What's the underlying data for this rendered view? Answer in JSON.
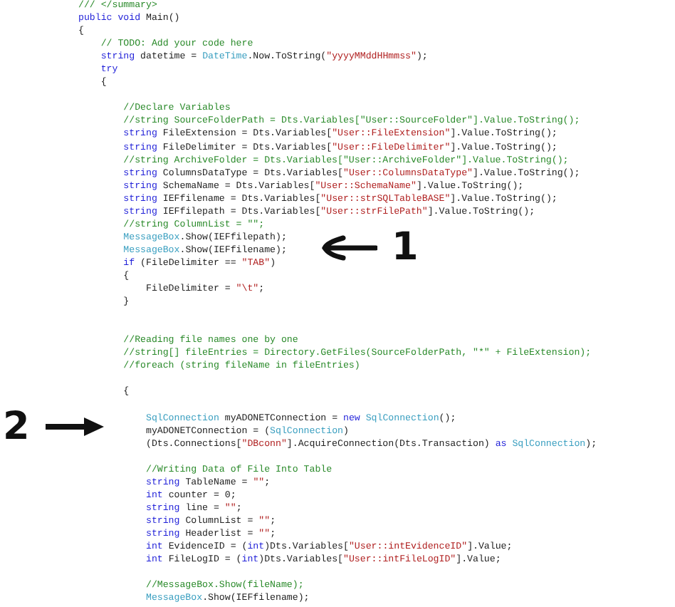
{
  "code_lines": [
    {
      "kind": "code",
      "tokens": [
        {
          "kind": "comment",
          "text": "/// </summary>"
        }
      ]
    },
    {
      "kind": "code",
      "tokens": [
        {
          "kind": "keyword",
          "text": "public void"
        },
        {
          "kind": "plain",
          "text": " Main()"
        }
      ]
    },
    {
      "kind": "code",
      "tokens": [
        {
          "kind": "plain",
          "text": "{"
        }
      ]
    },
    {
      "kind": "code",
      "tokens": [
        {
          "kind": "comment",
          "text": "    // TODO: Add your code here"
        }
      ]
    },
    {
      "kind": "code",
      "tokens": [
        {
          "kind": "keyword",
          "text": "    string"
        },
        {
          "kind": "plain",
          "text": " datetime = "
        },
        {
          "kind": "type",
          "text": "DateTime"
        },
        {
          "kind": "plain",
          "text": ".Now.ToString("
        },
        {
          "kind": "string",
          "text": "\"yyyyMMddHHmmss\""
        },
        {
          "kind": "plain",
          "text": ");"
        }
      ]
    },
    {
      "kind": "code",
      "tokens": [
        {
          "kind": "keyword",
          "text": "    try"
        }
      ]
    },
    {
      "kind": "code",
      "tokens": [
        {
          "kind": "plain",
          "text": "    {"
        }
      ]
    },
    {
      "kind": "blank"
    },
    {
      "kind": "code",
      "tokens": [
        {
          "kind": "comment",
          "text": "        //Declare Variables"
        }
      ]
    },
    {
      "kind": "code",
      "tokens": [
        {
          "kind": "comment",
          "text": "        //string SourceFolderPath = Dts.Variables[\"User::SourceFolder\"].Value.ToString();"
        }
      ]
    },
    {
      "kind": "code",
      "tokens": [
        {
          "kind": "keyword",
          "text": "        string"
        },
        {
          "kind": "plain",
          "text": " FileExtension = Dts.Variables["
        },
        {
          "kind": "string",
          "text": "\"User::FileExtension\""
        },
        {
          "kind": "plain",
          "text": "].Value.ToString();"
        }
      ]
    },
    {
      "kind": "code",
      "tokens": [
        {
          "kind": "keyword",
          "text": "        string"
        },
        {
          "kind": "plain",
          "text": " FileDelimiter = Dts.Variables["
        },
        {
          "kind": "string",
          "text": "\"User::FileDelimiter\""
        },
        {
          "kind": "plain",
          "text": "].Value.ToString();"
        }
      ]
    },
    {
      "kind": "code",
      "tokens": [
        {
          "kind": "comment",
          "text": "        //string ArchiveFolder = Dts.Variables[\"User::ArchiveFolder\"].Value.ToString();"
        }
      ]
    },
    {
      "kind": "code",
      "tokens": [
        {
          "kind": "keyword",
          "text": "        string"
        },
        {
          "kind": "plain",
          "text": " ColumnsDataType = Dts.Variables["
        },
        {
          "kind": "string",
          "text": "\"User::ColumnsDataType\""
        },
        {
          "kind": "plain",
          "text": "].Value.ToString();"
        }
      ]
    },
    {
      "kind": "code",
      "tokens": [
        {
          "kind": "keyword",
          "text": "        string"
        },
        {
          "kind": "plain",
          "text": " SchemaName = Dts.Variables["
        },
        {
          "kind": "string",
          "text": "\"User::SchemaName\""
        },
        {
          "kind": "plain",
          "text": "].Value.ToString();"
        }
      ]
    },
    {
      "kind": "code",
      "tokens": [
        {
          "kind": "keyword",
          "text": "        string"
        },
        {
          "kind": "plain",
          "text": " IEFfilename = Dts.Variables["
        },
        {
          "kind": "string",
          "text": "\"User::strSQLTableBASE\""
        },
        {
          "kind": "plain",
          "text": "].Value.ToString();"
        }
      ]
    },
    {
      "kind": "code",
      "tokens": [
        {
          "kind": "keyword",
          "text": "        string"
        },
        {
          "kind": "plain",
          "text": " IEFfilepath = Dts.Variables["
        },
        {
          "kind": "string",
          "text": "\"User::strFilePath\""
        },
        {
          "kind": "plain",
          "text": "].Value.ToString();"
        }
      ]
    },
    {
      "kind": "code",
      "tokens": [
        {
          "kind": "comment",
          "text": "        //string ColumnList = \"\";"
        }
      ]
    },
    {
      "kind": "code",
      "tokens": [
        {
          "kind": "type",
          "text": "        MessageBox"
        },
        {
          "kind": "plain",
          "text": ".Show(IEFfilepath);"
        }
      ]
    },
    {
      "kind": "code",
      "tokens": [
        {
          "kind": "type",
          "text": "        MessageBox"
        },
        {
          "kind": "plain",
          "text": ".Show(IEFfilename);"
        }
      ]
    },
    {
      "kind": "code",
      "tokens": [
        {
          "kind": "keyword",
          "text": "        if"
        },
        {
          "kind": "plain",
          "text": " (FileDelimiter == "
        },
        {
          "kind": "string",
          "text": "\"TAB\""
        },
        {
          "kind": "plain",
          "text": ")"
        }
      ]
    },
    {
      "kind": "code",
      "tokens": [
        {
          "kind": "plain",
          "text": "        {"
        }
      ]
    },
    {
      "kind": "code",
      "tokens": [
        {
          "kind": "plain",
          "text": "            FileDelimiter = "
        },
        {
          "kind": "string",
          "text": "\"\\t\""
        },
        {
          "kind": "plain",
          "text": ";"
        }
      ]
    },
    {
      "kind": "code",
      "tokens": [
        {
          "kind": "plain",
          "text": "        }"
        }
      ]
    },
    {
      "kind": "blank"
    },
    {
      "kind": "blank"
    },
    {
      "kind": "code",
      "tokens": [
        {
          "kind": "comment",
          "text": "        //Reading file names one by one"
        }
      ]
    },
    {
      "kind": "code",
      "tokens": [
        {
          "kind": "comment",
          "text": "        //string[] fileEntries = Directory.GetFiles(SourceFolderPath, \"*\" + FileExtension);"
        }
      ]
    },
    {
      "kind": "code",
      "tokens": [
        {
          "kind": "comment",
          "text": "        //foreach (string fileName in fileEntries)"
        }
      ]
    },
    {
      "kind": "blank"
    },
    {
      "kind": "code",
      "tokens": [
        {
          "kind": "plain",
          "text": "        {"
        }
      ]
    },
    {
      "kind": "blank"
    },
    {
      "kind": "code",
      "tokens": [
        {
          "kind": "type",
          "text": "            SqlConnection"
        },
        {
          "kind": "plain",
          "text": " myADONETConnection = "
        },
        {
          "kind": "keyword",
          "text": "new"
        },
        {
          "kind": "type",
          "text": " SqlConnection"
        },
        {
          "kind": "plain",
          "text": "();"
        }
      ]
    },
    {
      "kind": "code",
      "tokens": [
        {
          "kind": "plain",
          "text": "            myADONETConnection = ("
        },
        {
          "kind": "type",
          "text": "SqlConnection"
        },
        {
          "kind": "plain",
          "text": ")"
        }
      ]
    },
    {
      "kind": "code",
      "tokens": [
        {
          "kind": "plain",
          "text": "            (Dts.Connections["
        },
        {
          "kind": "string",
          "text": "\"DBconn\""
        },
        {
          "kind": "plain",
          "text": "].AcquireConnection(Dts.Transaction) "
        },
        {
          "kind": "keyword",
          "text": "as"
        },
        {
          "kind": "type",
          "text": " SqlConnection"
        },
        {
          "kind": "plain",
          "text": ");"
        }
      ]
    },
    {
      "kind": "blank"
    },
    {
      "kind": "code",
      "tokens": [
        {
          "kind": "comment",
          "text": "            //Writing Data of File Into Table"
        }
      ]
    },
    {
      "kind": "code",
      "tokens": [
        {
          "kind": "keyword",
          "text": "            string"
        },
        {
          "kind": "plain",
          "text": " TableName = "
        },
        {
          "kind": "string",
          "text": "\"\""
        },
        {
          "kind": "plain",
          "text": ";"
        }
      ]
    },
    {
      "kind": "code",
      "tokens": [
        {
          "kind": "keyword",
          "text": "            int"
        },
        {
          "kind": "plain",
          "text": " counter = 0;"
        }
      ]
    },
    {
      "kind": "code",
      "tokens": [
        {
          "kind": "keyword",
          "text": "            string"
        },
        {
          "kind": "plain",
          "text": " line = "
        },
        {
          "kind": "string",
          "text": "\"\""
        },
        {
          "kind": "plain",
          "text": ";"
        }
      ]
    },
    {
      "kind": "code",
      "tokens": [
        {
          "kind": "keyword",
          "text": "            string"
        },
        {
          "kind": "plain",
          "text": " ColumnList = "
        },
        {
          "kind": "string",
          "text": "\"\""
        },
        {
          "kind": "plain",
          "text": ";"
        }
      ]
    },
    {
      "kind": "code",
      "tokens": [
        {
          "kind": "keyword",
          "text": "            string"
        },
        {
          "kind": "plain",
          "text": " Headerlist = "
        },
        {
          "kind": "string",
          "text": "\"\""
        },
        {
          "kind": "plain",
          "text": ";"
        }
      ]
    },
    {
      "kind": "code",
      "tokens": [
        {
          "kind": "keyword",
          "text": "            int"
        },
        {
          "kind": "plain",
          "text": " EvidenceID = ("
        },
        {
          "kind": "keyword",
          "text": "int"
        },
        {
          "kind": "plain",
          "text": ")Dts.Variables["
        },
        {
          "kind": "string",
          "text": "\"User::intEvidenceID\""
        },
        {
          "kind": "plain",
          "text": "].Value;"
        }
      ]
    },
    {
      "kind": "code",
      "tokens": [
        {
          "kind": "keyword",
          "text": "            int"
        },
        {
          "kind": "plain",
          "text": " FileLogID = ("
        },
        {
          "kind": "keyword",
          "text": "int"
        },
        {
          "kind": "plain",
          "text": ")Dts.Variables["
        },
        {
          "kind": "string",
          "text": "\"User::intFileLogID\""
        },
        {
          "kind": "plain",
          "text": "].Value;"
        }
      ]
    },
    {
      "kind": "blank"
    },
    {
      "kind": "code",
      "tokens": [
        {
          "kind": "comment",
          "text": "            //MessageBox.Show(fileName);"
        }
      ]
    },
    {
      "kind": "code",
      "tokens": [
        {
          "kind": "type",
          "text": "            MessageBox"
        },
        {
          "kind": "plain",
          "text": ".Show(IEFfilename);"
        }
      ]
    }
  ],
  "annotations": [
    {
      "label": "1",
      "kind": "arrow-left"
    },
    {
      "label": "2",
      "kind": "arrow-right"
    }
  ]
}
